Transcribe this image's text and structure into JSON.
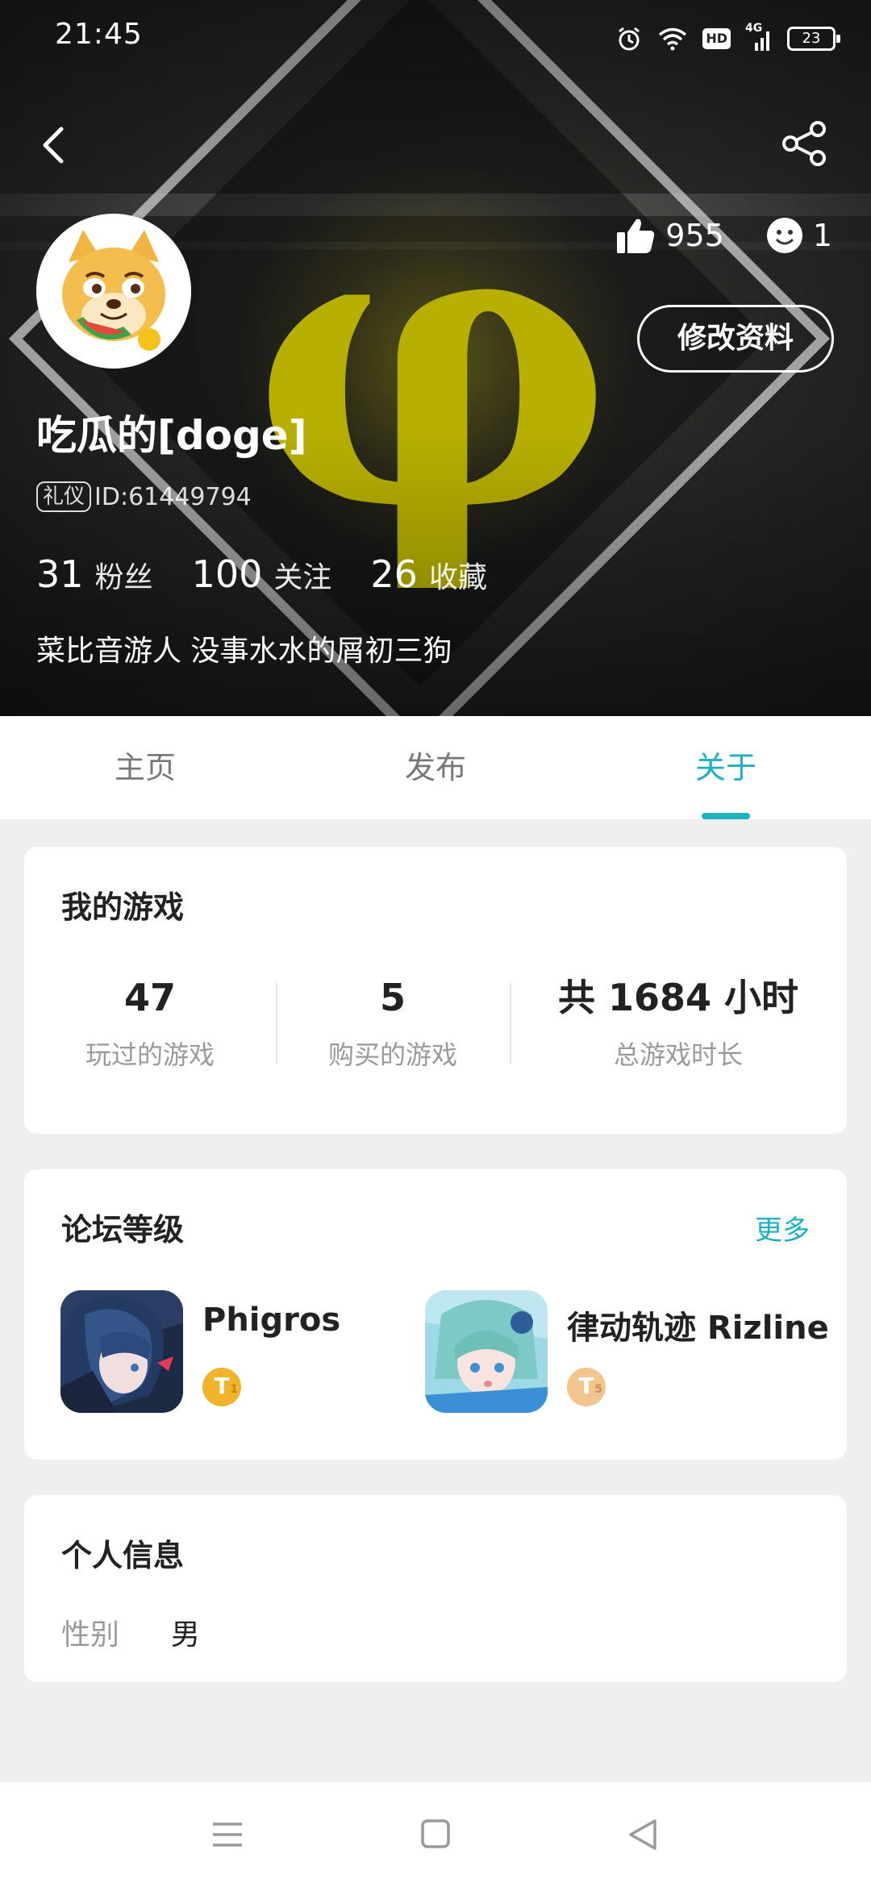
{
  "status_bar": {
    "time": "21:45",
    "network": "4G",
    "hd": "HD",
    "battery": "23"
  },
  "header": {
    "likes": "955",
    "emoji_count": "1",
    "edit_button": "修改资料",
    "nickname": "吃瓜的[doge]",
    "badge": "礼仪",
    "user_id": "ID:61449794",
    "stats": [
      {
        "value": "31",
        "label": "粉丝"
      },
      {
        "value": "100",
        "label": "关注"
      },
      {
        "value": "26",
        "label": "收藏"
      }
    ],
    "bio": "菜比音游人 没事水水的屑初三狗",
    "accent_color": "#1fb1bf"
  },
  "tabs": [
    {
      "label": "主页",
      "active": false
    },
    {
      "label": "发布",
      "active": false
    },
    {
      "label": "关于",
      "active": true
    }
  ],
  "my_games": {
    "title": "我的游戏",
    "stats": [
      {
        "value": "47",
        "label": "玩过的游戏"
      },
      {
        "value": "5",
        "label": "购买的游戏"
      },
      {
        "value": "共 1684 小时",
        "label": "总游戏时长"
      }
    ]
  },
  "forum_level": {
    "title": "论坛等级",
    "more": "更多",
    "items": [
      {
        "name": "Phigros",
        "tier": "T",
        "tier_level": "1",
        "tier_color": "#f0b32a"
      },
      {
        "name": "律动轨迹 Rizline",
        "tier": "T",
        "tier_level": "5",
        "tier_color": "#f2c48e"
      }
    ]
  },
  "personal_info": {
    "title": "个人信息",
    "gender_label": "性别",
    "gender_value": "男"
  }
}
